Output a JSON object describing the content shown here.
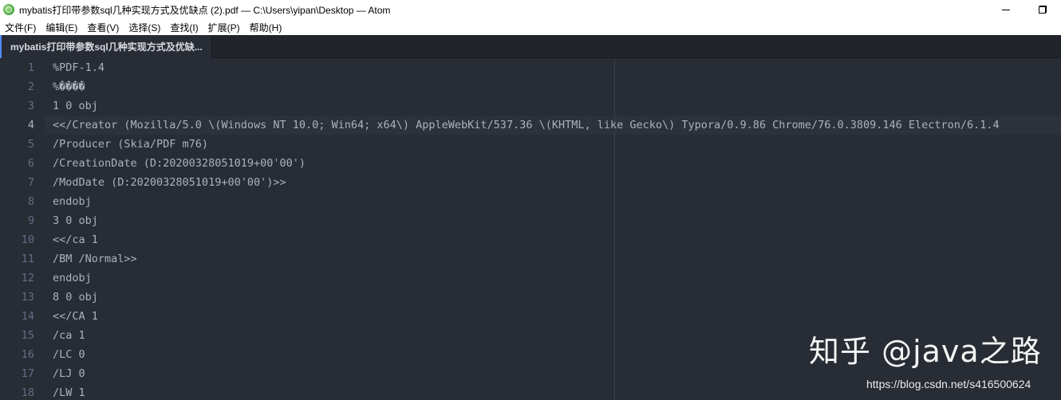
{
  "window": {
    "title": "mybatis打印带参数sql几种实现方式及优缺点 (2).pdf — C:\\Users\\yipan\\Desktop — Atom",
    "icon": "atom-icon"
  },
  "menu": {
    "items": [
      "文件(F)",
      "编辑(E)",
      "查看(V)",
      "选择(S)",
      "查找(I)",
      "扩展(P)",
      "帮助(H)"
    ]
  },
  "tabs": [
    {
      "label": "mybatis打印带参数sql几种实现方式及优缺...",
      "active": true
    }
  ],
  "editor": {
    "lines": [
      {
        "number": "1",
        "text": "%PDF-1.4"
      },
      {
        "number": "2",
        "text": "%����"
      },
      {
        "number": "3",
        "text": "1 0 obj"
      },
      {
        "number": "4",
        "text": "<</Creator (Mozilla/5.0 \\(Windows NT 10.0; Win64; x64\\) AppleWebKit/537.36 \\(KHTML, like Gecko\\) Typora/0.9.86 Chrome/76.0.3809.146 Electron/6.1.4"
      },
      {
        "number": "5",
        "text": "/Producer (Skia/PDF m76)"
      },
      {
        "number": "6",
        "text": "/CreationDate (D:20200328051019+00'00')"
      },
      {
        "number": "7",
        "text": "/ModDate (D:20200328051019+00'00')>>"
      },
      {
        "number": "8",
        "text": "endobj"
      },
      {
        "number": "9",
        "text": "3 0 obj"
      },
      {
        "number": "10",
        "text": "<</ca 1"
      },
      {
        "number": "11",
        "text": "/BM /Normal>>"
      },
      {
        "number": "12",
        "text": "endobj"
      },
      {
        "number": "13",
        "text": "8 0 obj"
      },
      {
        "number": "14",
        "text": "<</CA 1"
      },
      {
        "number": "15",
        "text": "/ca 1"
      },
      {
        "number": "16",
        "text": "/LC 0"
      },
      {
        "number": "17",
        "text": "/LJ 0"
      },
      {
        "number": "18",
        "text": "/LW 1"
      }
    ],
    "cursor_line": "4"
  },
  "watermark": {
    "main": "知乎 @java之路",
    "url": "https://blog.csdn.net/s416500624"
  },
  "colors": {
    "editor_bg": "#282c34",
    "tab_bar_bg": "#21252b",
    "text": "#abb2bf",
    "gutter_text": "#636d83",
    "accent": "#528bff"
  }
}
